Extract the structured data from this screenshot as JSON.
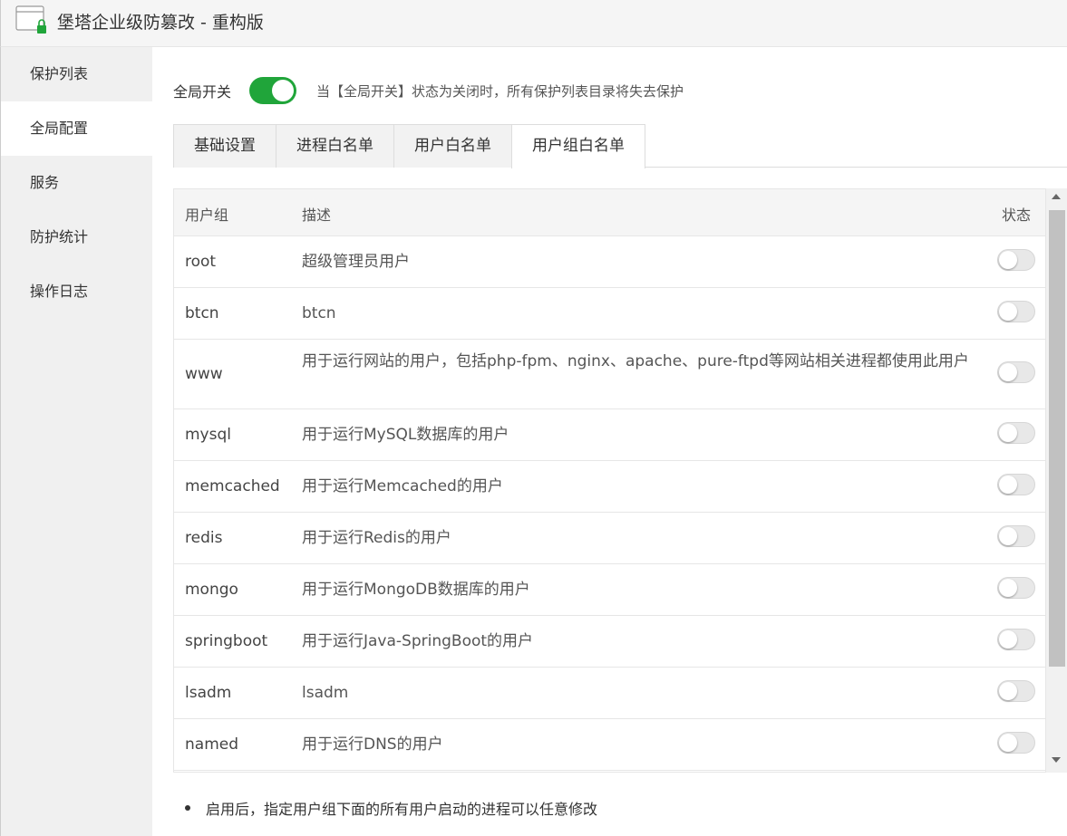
{
  "window": {
    "title": "堡塔企业级防篡改 - 重构版"
  },
  "colors": {
    "accent": "#20a53a",
    "toggle_off": "#e8e8e8"
  },
  "sidebar": {
    "items": [
      {
        "label": "保护列表",
        "active": false
      },
      {
        "label": "全局配置",
        "active": true
      },
      {
        "label": "服务",
        "active": false
      },
      {
        "label": "防护统计",
        "active": false
      },
      {
        "label": "操作日志",
        "active": false
      }
    ]
  },
  "global": {
    "label": "全局开关",
    "enabled": true,
    "tip": "当【全局开关】状态为关闭时，所有保护列表目录将失去保护"
  },
  "tabs": [
    {
      "label": "基础设置",
      "active": false
    },
    {
      "label": "进程白名单",
      "active": false
    },
    {
      "label": "用户白名单",
      "active": false
    },
    {
      "label": "用户组白名单",
      "active": true
    }
  ],
  "table": {
    "headers": {
      "group": "用户组",
      "desc": "描述",
      "status": "状态"
    },
    "rows": [
      {
        "group": "root",
        "desc": "超级管理员用户",
        "enabled": false
      },
      {
        "group": "btcn",
        "desc": "btcn",
        "enabled": false
      },
      {
        "group": "www",
        "desc": "用于运行网站的用户，包括php-fpm、nginx、apache、pure-ftpd等网站相关进程都使用此用户",
        "enabled": false
      },
      {
        "group": "mysql",
        "desc": "用于运行MySQL数据库的用户",
        "enabled": false
      },
      {
        "group": "memcached",
        "desc": "用于运行Memcached的用户",
        "enabled": false
      },
      {
        "group": "redis",
        "desc": "用于运行Redis的用户",
        "enabled": false
      },
      {
        "group": "mongo",
        "desc": "用于运行MongoDB数据库的用户",
        "enabled": false
      },
      {
        "group": "springboot",
        "desc": "用于运行Java-SpringBoot的用户",
        "enabled": false
      },
      {
        "group": "lsadm",
        "desc": "lsadm",
        "enabled": false
      },
      {
        "group": "named",
        "desc": "用于运行DNS的用户",
        "enabled": false
      }
    ]
  },
  "note": "启用后，指定用户组下面的所有用户启动的进程可以任意修改"
}
